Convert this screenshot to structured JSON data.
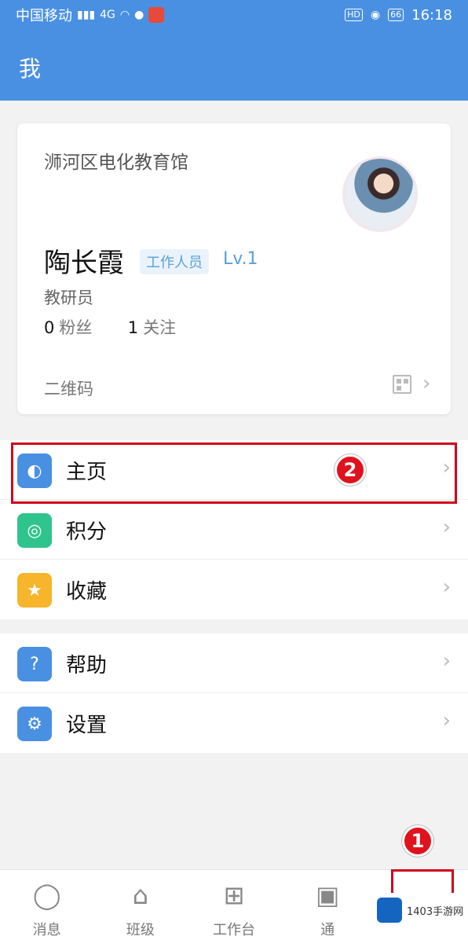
{
  "status": {
    "carrier": "中国移动",
    "net": "4G",
    "hd": "HD",
    "battery": "66",
    "time": "16:18"
  },
  "nav": {
    "title": "我"
  },
  "profile": {
    "org": "浉河区电化教育馆",
    "name": "陶长霞",
    "tag": "工作人员",
    "level": "Lv.1",
    "role": "教研员",
    "fans_count": "0",
    "fans_label": "粉丝",
    "follow_count": "1",
    "follow_label": "关注",
    "qr_label": "二维码"
  },
  "menu1": [
    {
      "label": "主页",
      "icon": "homepage-icon",
      "color": "#4a90e2"
    },
    {
      "label": "积分",
      "icon": "points-icon",
      "color": "#2fc48d"
    },
    {
      "label": "收藏",
      "icon": "star-icon",
      "color": "#f6b52a"
    }
  ],
  "menu2": [
    {
      "label": "帮助",
      "icon": "help-icon",
      "color": "#4a90e2"
    },
    {
      "label": "设置",
      "icon": "gear-icon",
      "color": "#4a90e2"
    }
  ],
  "callouts": {
    "one": "1",
    "two": "2"
  },
  "tabs": [
    {
      "label": "消息",
      "icon": "message-icon"
    },
    {
      "label": "班级",
      "icon": "home-icon"
    },
    {
      "label": "工作台",
      "icon": "workbench-icon"
    },
    {
      "label": "通",
      "icon": "contacts-icon"
    },
    {
      "label": "",
      "icon": "me-icon"
    }
  ],
  "watermark": {
    "text": "1403手游网"
  }
}
